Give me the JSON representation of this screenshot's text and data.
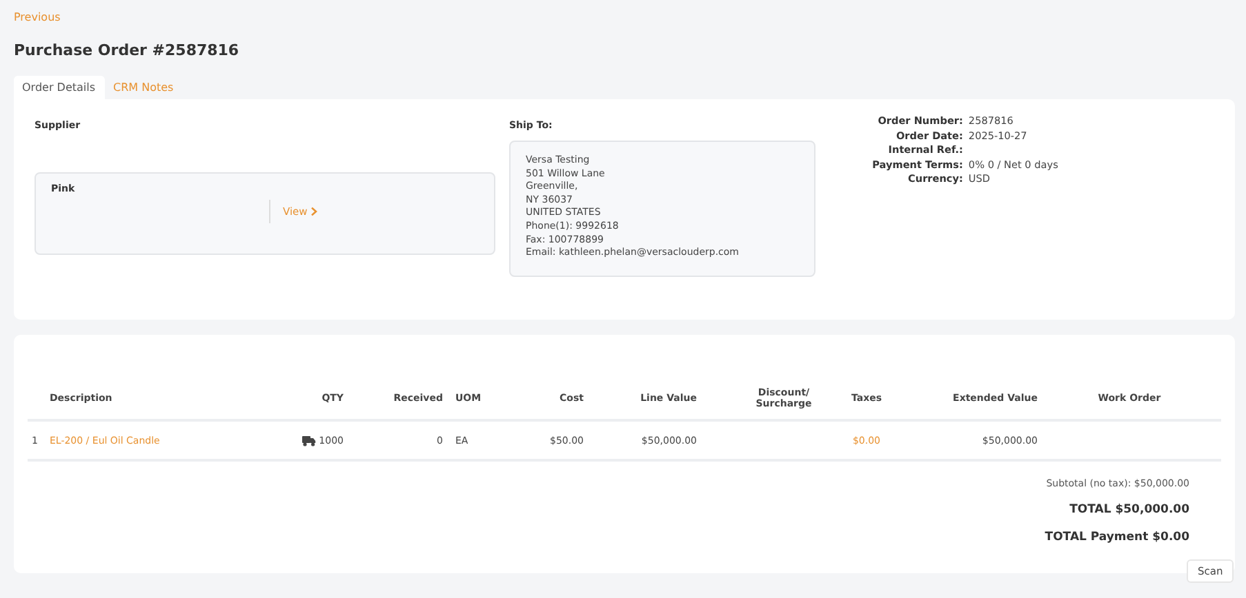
{
  "back_link": "Previous",
  "title": "Purchase Order #2587816",
  "tabs": [
    {
      "label": "Order Details",
      "selected": true
    },
    {
      "label": "CRM Notes",
      "selected": false
    }
  ],
  "supplier": {
    "heading": "Supplier",
    "name": "Pink",
    "link": "View"
  },
  "ship_to": {
    "heading": "Ship To:",
    "lines": [
      "Versa Testing",
      "501 Willow Lane",
      "Greenville,",
      "NY 36037",
      "UNITED STATES",
      "Phone(1): 9992618",
      "Fax: 100778899",
      "Email: kathleen.phelan@versaclouderp.com"
    ]
  },
  "order_info": [
    {
      "label": "Order Number:",
      "value": "2587816"
    },
    {
      "label": "Order Date:",
      "value": "2025-10-27"
    },
    {
      "label": "Internal Ref.:"
    },
    {
      "label": "Payment Terms:",
      "value": "0% 0 / Net 0 days"
    },
    {
      "label": "Currency:",
      "value": "USD"
    }
  ],
  "table": {
    "columns": [
      null,
      "Description",
      "QTY",
      "Received",
      "UOM",
      "Cost",
      "Line Value",
      "Discount/\nSurcharge",
      "Taxes",
      "Extended Value",
      "Work Order"
    ],
    "rows": [
      {
        "cells": [
          "1",
          "EL-200 / Eul Oil Candle",
          "1000",
          "0",
          "EA",
          "$50.00",
          "$50,000.00",
          null,
          "$0.00",
          "$50,000.00",
          null
        ],
        "shipping": true
      }
    ]
  },
  "totals": {
    "subtotal": "Subtotal (no tax): $50,000.00",
    "total": "TOTAL $50,000.00",
    "payment": "TOTAL Payment $0.00"
  },
  "scan_button": "Scan"
}
